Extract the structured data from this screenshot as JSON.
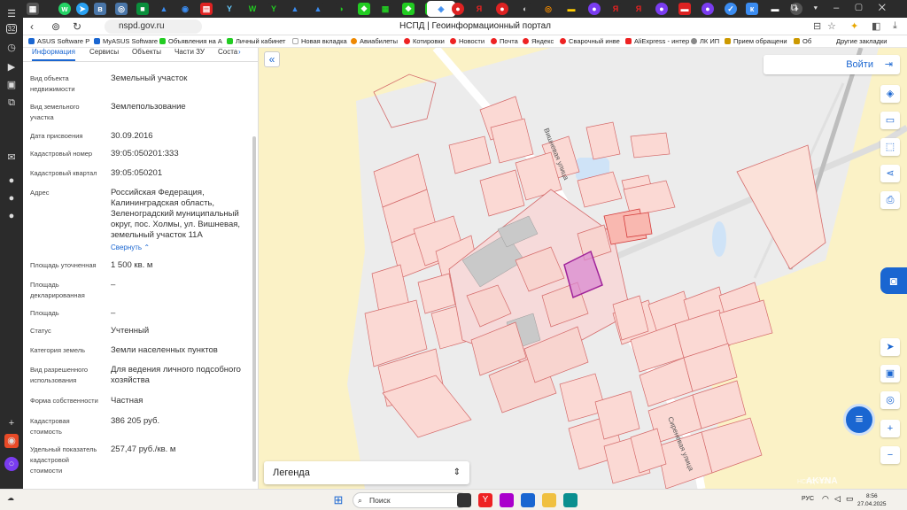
{
  "browser": {
    "tab_count_badge": "32",
    "url": "nspd.gov.ru",
    "page_title": "НСПД | Геоинформационный портал",
    "bookmarks": [
      "ASUS Software P",
      "MyASUS Software",
      "Объявления на А",
      "Личный кабинет",
      "Новая вкладка",
      "Авиабилеты",
      "Котировки",
      "Новости",
      "Почта",
      "Яндекс",
      "Сварочный инве",
      "AliExpress - интер",
      "ЛК ИП",
      "Прием обращени",
      "Об"
    ],
    "other_bookmarks": "Другие закладки"
  },
  "panel": {
    "tabs": [
      "Информация",
      "Сервисы",
      "Объекты",
      "Части ЗУ",
      "Соста"
    ],
    "collapse_label": "Свернуть",
    "rows": [
      {
        "label": "Вид объекта недвижимости",
        "value": "Земельный участок"
      },
      {
        "label": "Вид земельного участка",
        "value": "Землепользование"
      },
      {
        "label": "Дата присвоения",
        "value": "30.09.2016"
      },
      {
        "label": "Кадастровый номер",
        "value": "39:05:050201:333"
      },
      {
        "label": "Кадастровый квартал",
        "value": "39:05:050201"
      },
      {
        "label": "Адрес",
        "value": "Российская Федерация, Калининградская область, Зеленоградский муниципальный округ, пос. Холмы, ул. Вишневая, земельный участок 11А"
      },
      {
        "label": "Площадь уточненная",
        "value": "1 500 кв. м"
      },
      {
        "label": "Площадь декларированная",
        "value": "–"
      },
      {
        "label": "Площадь",
        "value": "–"
      },
      {
        "label": "Статус",
        "value": "Учтенный"
      },
      {
        "label": "Категория земель",
        "value": "Земли населенных пунктов"
      },
      {
        "label": "Вид разрешенного использования",
        "value": "Для ведения личного подсобного хозяйства"
      },
      {
        "label": "Форма собственности",
        "value": "Частная"
      },
      {
        "label": "Кадастровая стоимость",
        "value": "386 205 руб."
      },
      {
        "label": "Удельный показатель кадастровой стоимости",
        "value": "257,47 руб./кв. м"
      }
    ]
  },
  "map": {
    "login_label": "Войти",
    "legend_label": "Легенда",
    "street_1": "Вишневая улица",
    "street_2": "Сиреневая улица",
    "watermark": "AKYNA",
    "watermark_small": "НСПД 2025"
  },
  "taskbar": {
    "search_placeholder": "Поиск",
    "lang": "РУС",
    "time": "8:56",
    "date": "27.04.2025"
  }
}
